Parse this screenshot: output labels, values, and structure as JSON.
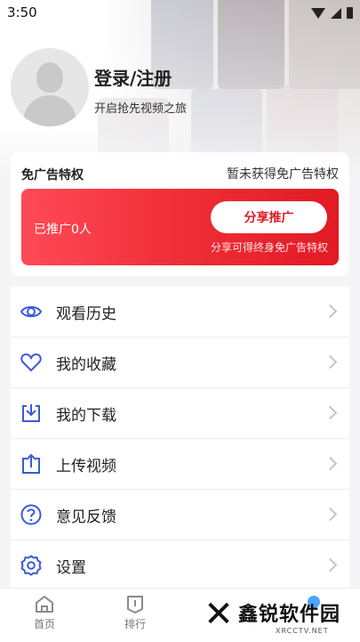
{
  "status_bar": {
    "time": "3:50"
  },
  "profile": {
    "title": "登录/注册",
    "subtitle": "开启抢先视频之旅"
  },
  "ad_free": {
    "title": "免广告特权",
    "status": "暂未获得免广告特权",
    "promo_count": "已推广0人",
    "share_button": "分享推广",
    "note": "分享可得终身免广告特权"
  },
  "menu": [
    {
      "label": "观看历史",
      "icon": "eye-icon"
    },
    {
      "label": "我的收藏",
      "icon": "heart-icon"
    },
    {
      "label": "我的下载",
      "icon": "download-icon"
    },
    {
      "label": "上传视频",
      "icon": "upload-icon"
    },
    {
      "label": "意见反馈",
      "icon": "question-icon"
    },
    {
      "label": "设置",
      "icon": "gear-icon"
    }
  ],
  "tabs": [
    {
      "label": "首页",
      "icon": "home-icon"
    },
    {
      "label": "排行",
      "icon": "ranking-icon"
    }
  ],
  "watermark": {
    "brand": "鑫锐软件园",
    "site": "XRCCTV.NET"
  },
  "colors": {
    "accent": "#3a5bd9",
    "promo_red": "#f0303a",
    "text": "#222222"
  }
}
